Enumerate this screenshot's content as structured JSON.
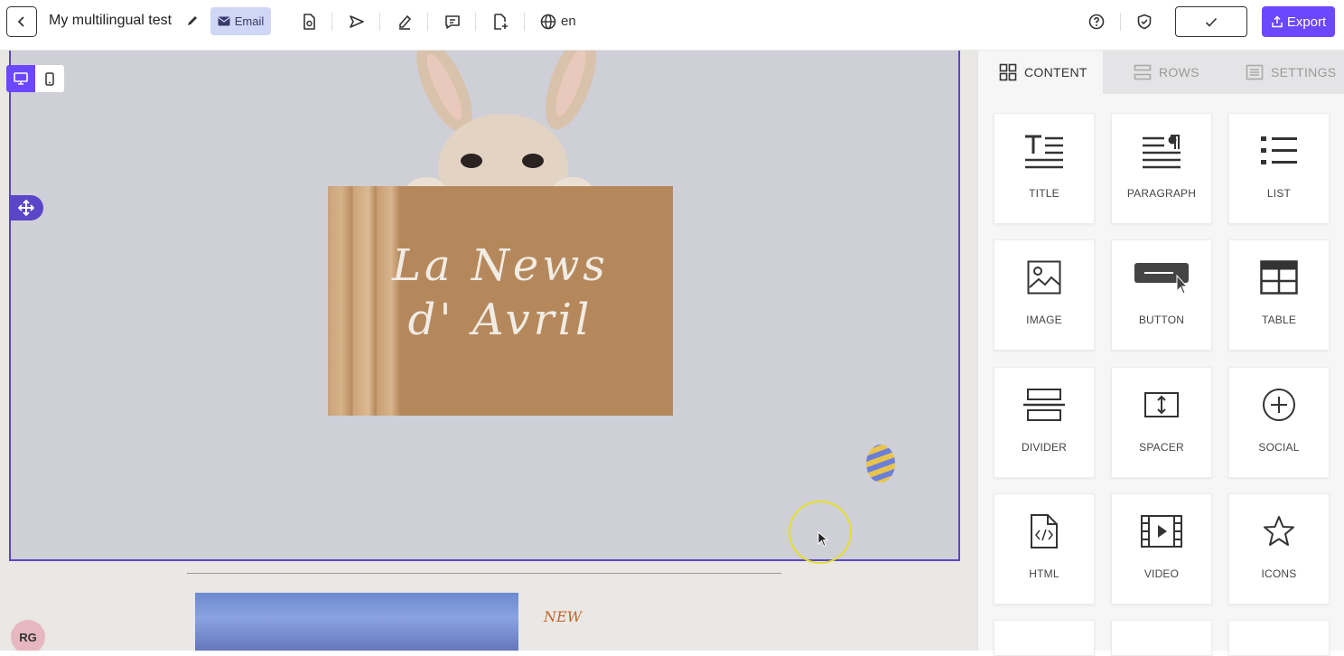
{
  "header": {
    "title": "My multilingual test",
    "email_label": "Email",
    "language": "en",
    "export_label": "Export"
  },
  "canvas": {
    "sign_line1": "La News",
    "sign_line2": "d' Avril",
    "new_label": "NEW",
    "avatar_initials": "RG"
  },
  "panel": {
    "tabs": [
      {
        "label": "CONTENT",
        "icon": "grid-icon"
      },
      {
        "label": "ROWS",
        "icon": "rows-icon"
      },
      {
        "label": "SETTINGS",
        "icon": "settings-icon"
      }
    ],
    "tiles": [
      {
        "label": "TITLE",
        "icon": "title-icon"
      },
      {
        "label": "PARAGRAPH",
        "icon": "paragraph-icon"
      },
      {
        "label": "LIST",
        "icon": "list-icon"
      },
      {
        "label": "IMAGE",
        "icon": "image-icon"
      },
      {
        "label": "BUTTON",
        "icon": "button-icon"
      },
      {
        "label": "TABLE",
        "icon": "table-icon"
      },
      {
        "label": "DIVIDER",
        "icon": "divider-icon"
      },
      {
        "label": "SPACER",
        "icon": "spacer-icon"
      },
      {
        "label": "SOCIAL",
        "icon": "social-icon"
      },
      {
        "label": "HTML",
        "icon": "html-icon"
      },
      {
        "label": "VIDEO",
        "icon": "video-icon"
      },
      {
        "label": "ICONS",
        "icon": "star-icon"
      }
    ]
  },
  "colors": {
    "accent": "#6c47ff",
    "selection_border": "#5b45c8",
    "email_chip": "#cfd6f6"
  }
}
